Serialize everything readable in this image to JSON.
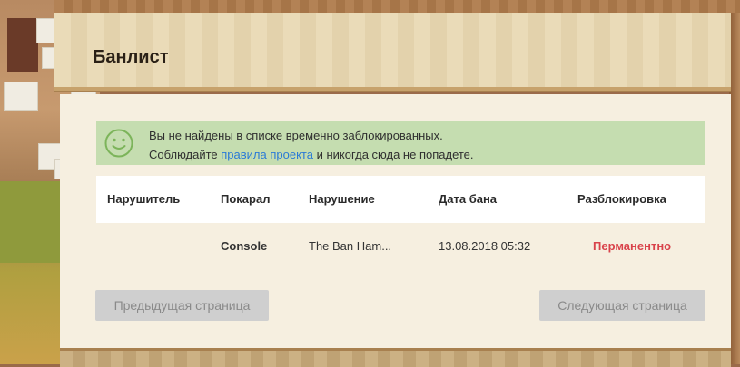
{
  "page": {
    "title": "Банлист"
  },
  "notice": {
    "icon": "smiley-icon",
    "line1": "Вы не найдены в списке временно заблокированных.",
    "line2_before": "Соблюдайте ",
    "line2_link": "правила проекта",
    "line2_after": " и никогда сюда не попадете.",
    "bg_color": "#c5ddb0",
    "link_color": "#2a7ad6"
  },
  "table": {
    "headers": {
      "offender": "Нарушитель",
      "punisher": "Покарал",
      "violation": "Нарушение",
      "ban_date": "Дата бана",
      "unban": "Разблокировка"
    },
    "rows": [
      {
        "offender": "",
        "punisher": "Console",
        "violation": "The Ban Ham...",
        "ban_date": "13.08.2018 05:32",
        "unban": "Перманентно"
      }
    ]
  },
  "pagination": {
    "prev_label": "Предыдущая страница",
    "next_label": "Следующая страница"
  },
  "colors": {
    "unban_permanent": "#d9434b",
    "button_bg": "#cfcfcf"
  }
}
